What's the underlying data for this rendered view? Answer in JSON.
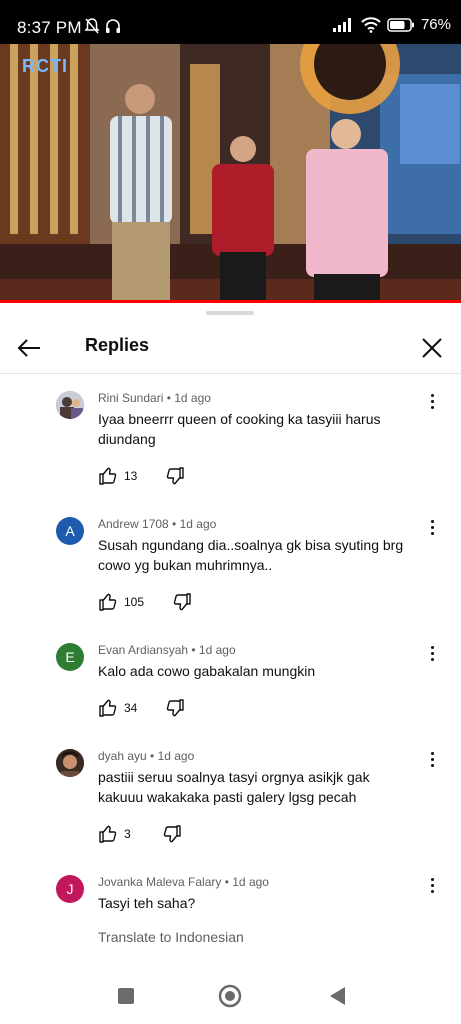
{
  "status_bar": {
    "time": "8:37 PM",
    "battery": "76%"
  },
  "video": {
    "channel_logo": "RCTI"
  },
  "sheet": {
    "title": "Replies"
  },
  "comments": [
    {
      "author": "Rini Sundari",
      "age": "1d ago",
      "meta": "Rini Sundari • 1d ago",
      "text": "Iyaa bneerrr queen of cooking ka tasyiii harus diundang",
      "likes": "13",
      "avatar_letter": "",
      "avatar_color": "#8a8fa0"
    },
    {
      "author": "Andrew 1708",
      "age": "1d ago",
      "meta": "Andrew 1708 • 1d ago",
      "text": "Susah ngundang dia..soalnya gk bisa syuting brg cowo yg bukan muhrimnya..",
      "likes": "105",
      "avatar_letter": "A",
      "avatar_color": "#1e5bad"
    },
    {
      "author": "Evan Ardiansyah",
      "age": "1d ago",
      "meta": "Evan Ardiansyah • 1d ago",
      "text": "Kalo ada cowo gabakalan mungkin",
      "likes": "34",
      "avatar_letter": "E",
      "avatar_color": "#2e7d32"
    },
    {
      "author": "dyah ayu",
      "age": "1d ago",
      "meta": "dyah ayu • 1d ago",
      "text": "pastiii seruu soalnya tasyi orgnya asikjk gak kakuuu wakakaka pasti galery lgsg pecah",
      "likes": "3",
      "avatar_letter": "",
      "avatar_color": "#5a3a2c"
    },
    {
      "author": "Jovanka Maleva Falary",
      "age": "1d ago",
      "meta": "Jovanka Maleva Falary • 1d ago",
      "text": "Tasyi teh saha?",
      "likes": "",
      "avatar_letter": "J",
      "avatar_color": "#c2185b"
    }
  ],
  "translate_label": "Translate to Indonesian",
  "colors": {
    "accent_red": "#ff0000",
    "secondary_text": "#606060"
  }
}
